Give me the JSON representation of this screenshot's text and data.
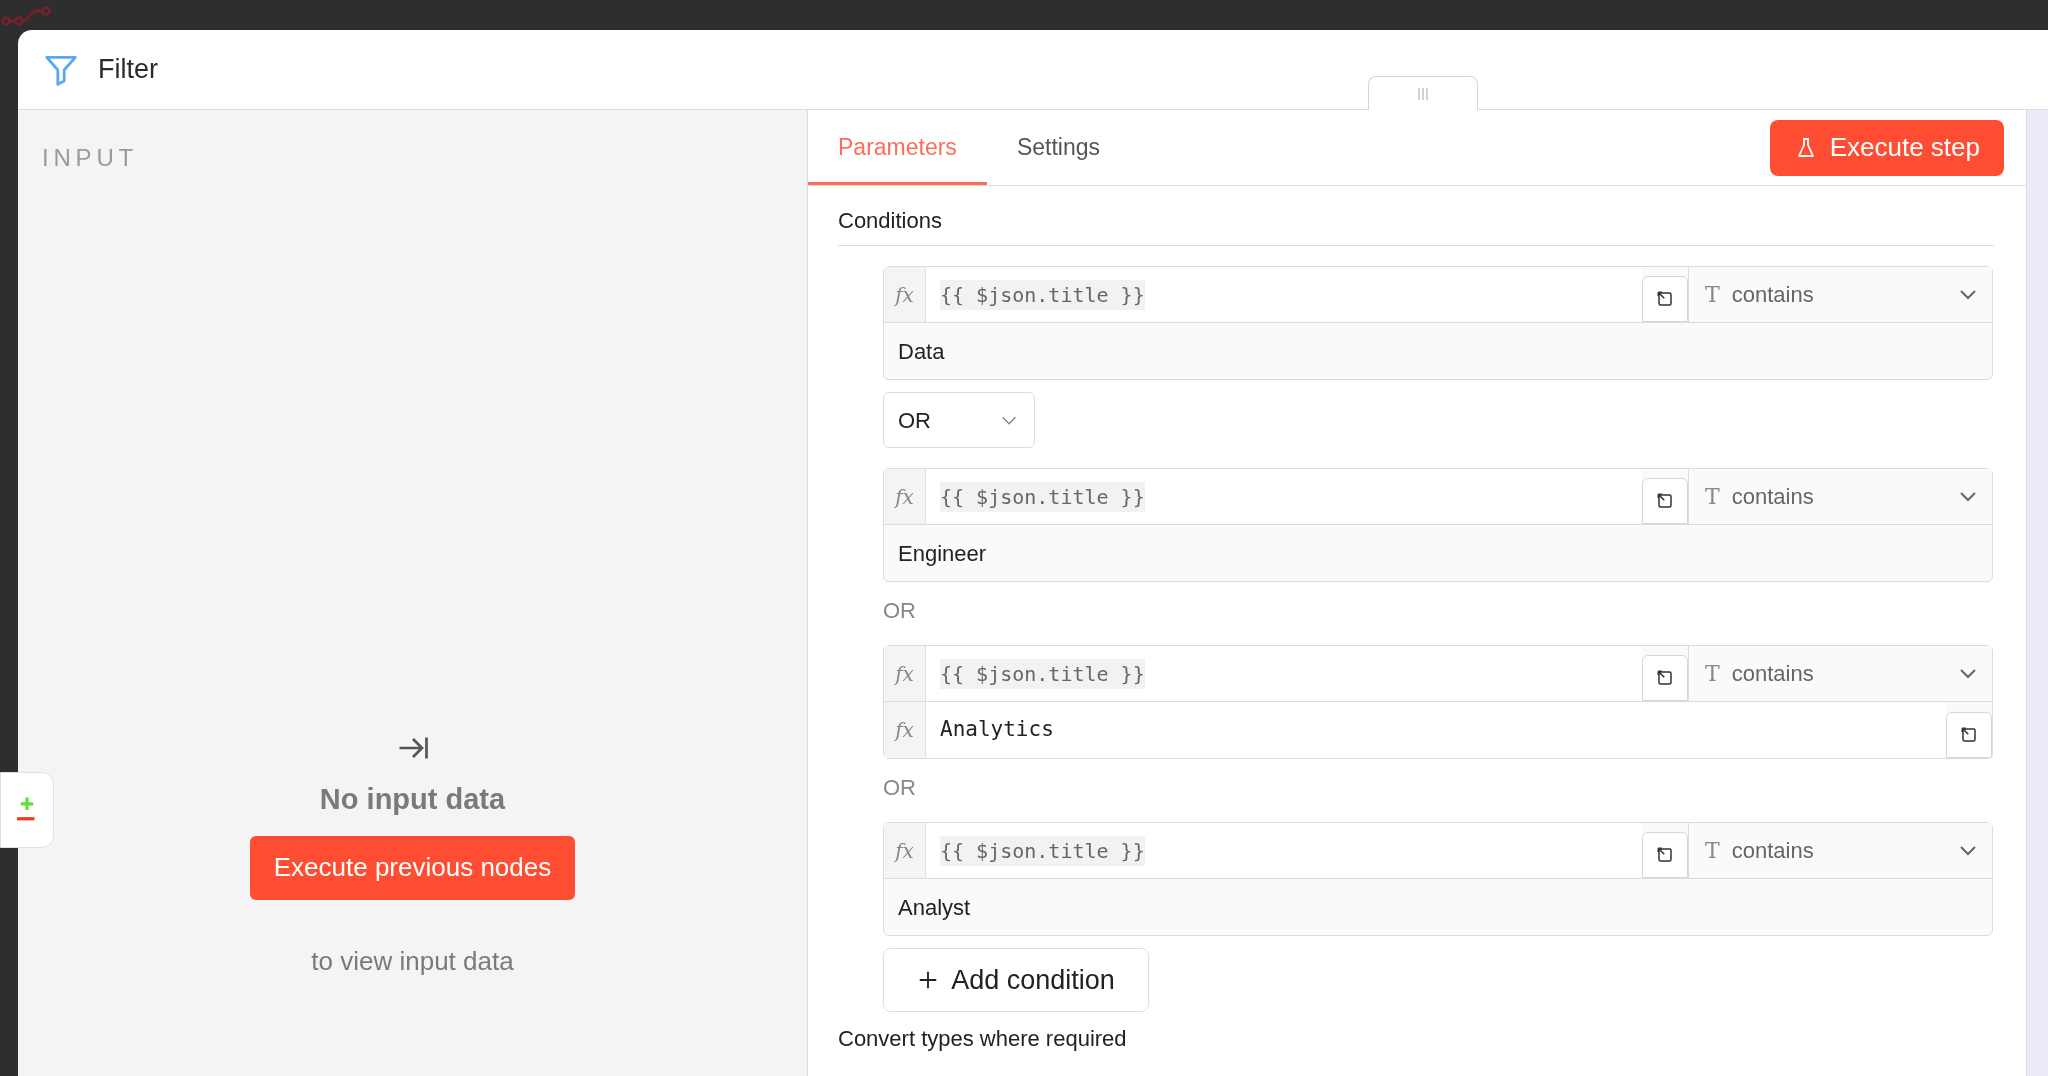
{
  "window": {
    "title": "Filter"
  },
  "input_panel": {
    "title": "INPUT",
    "empty_title": "No input data",
    "button": "Execute previous nodes",
    "hint": "to view input data"
  },
  "tabs": [
    {
      "label": "Parameters",
      "selected": true
    },
    {
      "label": "Settings",
      "selected": false
    }
  ],
  "execute_button": "Execute step",
  "conditions": {
    "label": "Conditions",
    "items": [
      {
        "kind": "condition",
        "left_badge": "fx",
        "left": "{{ $json.title }}",
        "type_glyph": "T",
        "operator": "contains",
        "right": "Data"
      },
      {
        "kind": "combinator_select",
        "value": "OR"
      },
      {
        "kind": "condition",
        "left_badge": "fx",
        "left": "{{ $json.title }}",
        "type_glyph": "T",
        "operator": "contains",
        "right": "Engineer"
      },
      {
        "kind": "combinator_label",
        "value": "OR"
      },
      {
        "kind": "condition",
        "left_badge": "fx",
        "left": "{{ $json.title }}",
        "type_glyph": "T",
        "operator": "contains",
        "right_badge": "fx",
        "right": "Analytics"
      },
      {
        "kind": "combinator_label",
        "value": "OR"
      },
      {
        "kind": "condition",
        "left_badge": "fx",
        "left": "{{ $json.title }}",
        "type_glyph": "T",
        "operator": "contains",
        "right": "Analyst"
      }
    ],
    "add_button": "Add condition"
  },
  "option_label": "Convert types where required"
}
